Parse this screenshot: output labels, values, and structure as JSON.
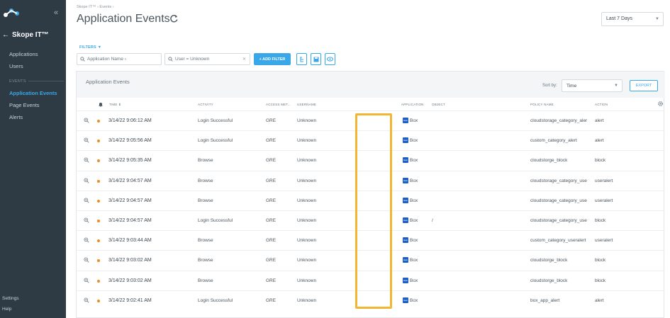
{
  "sidebar": {
    "tenant_name": "Skope IT™",
    "nav": [
      "Applications",
      "Users"
    ],
    "section_label": "EVENTS",
    "events_nav": [
      "Application Events",
      "Page Events",
      "Alerts"
    ],
    "bottom": [
      "Settings",
      "Help"
    ]
  },
  "header": {
    "breadcrumb": "Skope IT™ › Events ›",
    "title": "Application Events",
    "range": "Last 7 Days"
  },
  "filters": {
    "label": "FILTERS ▼",
    "app_name_placeholder": "Application Name ›",
    "user_filter": "User = Unknown",
    "add_filter_label": "+ ADD FILTER"
  },
  "panel": {
    "title": "Application Events",
    "sort_label": "Sort by:",
    "sort_value": "Time",
    "export_label": "EXPORT"
  },
  "columns": {
    "time": "TIME ⬇",
    "activity": "ACTIVITY",
    "access_method": "ACCESS MET...",
    "username": "USERNAME",
    "application": "APPLICATION",
    "object": "OBJECT",
    "policy_name": "POLICY NAME",
    "action": "ACTION"
  },
  "rows": [
    {
      "time": "3/14/22 9:06:12 AM",
      "activity": "Login Successful",
      "access": "GRE",
      "username": "Unknown",
      "app": "Box",
      "object": "",
      "policy": "cloudstorage_category_aler",
      "action": "alert"
    },
    {
      "time": "3/14/22 9:05:56 AM",
      "activity": "Login Successful",
      "access": "GRE",
      "username": "Unknown",
      "app": "Box",
      "object": "",
      "policy": "custom_category_alert",
      "action": "alert"
    },
    {
      "time": "3/14/22 9:05:35 AM",
      "activity": "Browse",
      "access": "GRE",
      "username": "Unknown",
      "app": "Box",
      "object": "",
      "policy": "cloudstorge_block",
      "action": "block"
    },
    {
      "time": "3/14/22 9:04:57 AM",
      "activity": "Browse",
      "access": "GRE",
      "username": "Unknown",
      "app": "Box",
      "object": "",
      "policy": "cloudstorage_category_use",
      "action": "useralert"
    },
    {
      "time": "3/14/22 9:04:57 AM",
      "activity": "Browse",
      "access": "GRE",
      "username": "Unknown",
      "app": "Box",
      "object": "",
      "policy": "cloudstorage_category_use",
      "action": "useralert"
    },
    {
      "time": "3/14/22 9:04:57 AM",
      "activity": "Login Successful",
      "access": "GRE",
      "username": "Unknown",
      "app": "Box",
      "object": "/",
      "policy": "cloudstorage_category_use",
      "action": "block"
    },
    {
      "time": "3/14/22 9:03:44 AM",
      "activity": "Browse",
      "access": "GRE",
      "username": "Unknown",
      "app": "Box",
      "object": "",
      "policy": "custom_category_useralert",
      "action": "useralert"
    },
    {
      "time": "3/14/22 9:03:02 AM",
      "activity": "Browse",
      "access": "GRE",
      "username": "Unknown",
      "app": "Box",
      "object": "",
      "policy": "cloudstorge_block",
      "action": "block"
    },
    {
      "time": "3/14/22 9:03:02 AM",
      "activity": "Browse",
      "access": "GRE",
      "username": "Unknown",
      "app": "Box",
      "object": "",
      "policy": "cloudstorge_block",
      "action": "block"
    },
    {
      "time": "3/14/22 9:02:41 AM",
      "activity": "Login Successful",
      "access": "GRE",
      "username": "Unknown",
      "app": "Box",
      "object": "",
      "policy": "box_app_alert",
      "action": "alert"
    }
  ],
  "app_icon_text": "box",
  "colors": {
    "sidebar": "#2e3a44",
    "accent": "#3aa8e8",
    "status_dot": "#f08a24",
    "highlight": "#f2b632",
    "box_brand": "#1d5fc4"
  },
  "icons": [
    "logo-icon",
    "collapse-icon",
    "back-arrow-icon",
    "refresh-icon",
    "search-icon",
    "filter-tree-icon",
    "save-icon",
    "eye-icon",
    "bell-icon",
    "zoom-icon",
    "box-app-icon",
    "gear-icon"
  ]
}
